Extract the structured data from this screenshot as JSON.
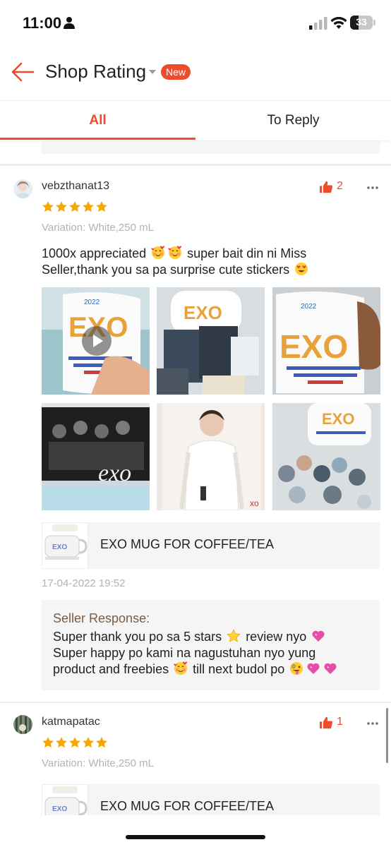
{
  "status_bar": {
    "time": "11:00",
    "battery": "33"
  },
  "header": {
    "title": "Shop Rating",
    "badge": "New"
  },
  "tabs": [
    {
      "label": "All"
    },
    {
      "label": "To Reply"
    }
  ],
  "reviews": [
    {
      "username": "vebzthanat13",
      "likes": "2",
      "stars": 5,
      "variation": "Variation: White,250 mL",
      "comment_part1": "1000x appreciated",
      "comment_part2": "super bait din ni Miss Seller,thank you sa pa surprise cute stickers",
      "photo_count": 6,
      "has_video": true,
      "product_name": "EXO MUG FOR COFFEE/TEA",
      "date": "17-04-2022 19:52",
      "seller_response": {
        "title": "Seller Response:",
        "line1_a": "Super thank you po sa 5 stars",
        "line1_b": "review nyo",
        "line2": "Super happy po kami na nagustuhan nyo yung",
        "line3_a": "product and freebies",
        "line3_b": "till next budol po"
      }
    },
    {
      "username": "katmapatac",
      "likes": "1",
      "stars": 5,
      "variation": "Variation: White,250 mL",
      "product_name": "EXO MUG FOR COFFEE/TEA"
    }
  ],
  "colors": {
    "accent": "#ee4d2d",
    "star": "#f6a700",
    "seller_title": "#7a5d42"
  },
  "icons": [
    "person-icon",
    "signal-icon",
    "wifi-icon",
    "battery-icon",
    "back-arrow-icon",
    "caret-down-icon",
    "thumbs-up-icon",
    "more-options-icon",
    "star-icon",
    "play-icon",
    "smiling-hearts-emoji",
    "heart-eyes-emoji",
    "star-emoji",
    "pink-heart-emoji",
    "zany-face-emoji"
  ]
}
